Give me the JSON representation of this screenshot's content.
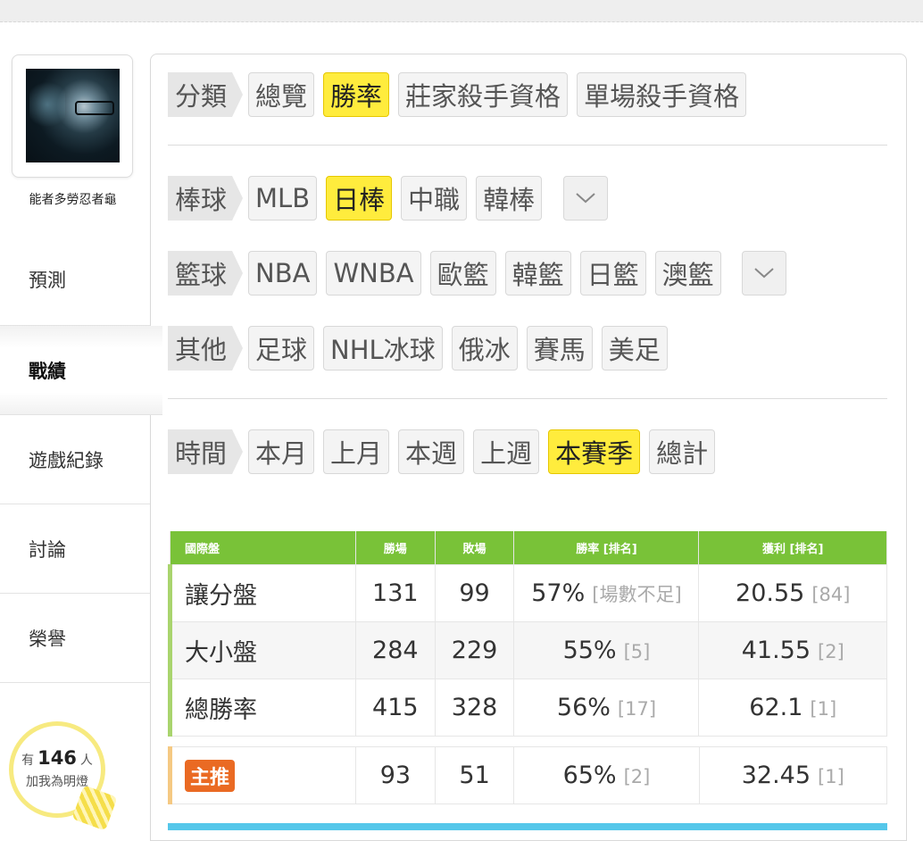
{
  "profile": {
    "username": "能者多勞忍者龜"
  },
  "nav": {
    "items": [
      {
        "label": "預測"
      },
      {
        "label": "戰績"
      },
      {
        "label": "遊戲紀錄"
      },
      {
        "label": "討論"
      },
      {
        "label": "榮譽"
      }
    ]
  },
  "fans": {
    "prefix": "有",
    "count": "146",
    "suffix": "人",
    "line2": "加我為明燈"
  },
  "filters": {
    "category": {
      "label": "分類",
      "options": [
        "總覽",
        "勝率",
        "莊家殺手資格",
        "單場殺手資格"
      ],
      "selected": "勝率"
    },
    "baseball": {
      "label": "棒球",
      "options": [
        "MLB",
        "日棒",
        "中職",
        "韓棒"
      ],
      "selected": "日棒"
    },
    "basketball": {
      "label": "籃球",
      "options": [
        "NBA",
        "WNBA",
        "歐籃",
        "韓籃",
        "日籃",
        "澳籃"
      ]
    },
    "other": {
      "label": "其他",
      "options": [
        "足球",
        "NHL冰球",
        "俄冰",
        "賽馬",
        "美足"
      ]
    },
    "time": {
      "label": "時間",
      "options": [
        "本月",
        "上月",
        "本週",
        "上週",
        "本賽季",
        "總計"
      ],
      "selected": "本賽季"
    }
  },
  "stats": {
    "headers": [
      "國際盤",
      "勝場",
      "敗場",
      "勝率 [排名]",
      "獲利 [排名]"
    ],
    "rows": [
      {
        "type": "讓分盤",
        "wins": "131",
        "losses": "99",
        "rate": "57%",
        "rate_rank": "[場數不足]",
        "profit": "20.55",
        "profit_rank": "[84]"
      },
      {
        "type": "大小盤",
        "wins": "284",
        "losses": "229",
        "rate": "55%",
        "rate_rank": "[5]",
        "profit": "41.55",
        "profit_rank": "[2]"
      },
      {
        "type": "總勝率",
        "wins": "415",
        "losses": "328",
        "rate": "56%",
        "rate_rank": "[17]",
        "profit": "62.1",
        "profit_rank": "[1]"
      }
    ],
    "main_pick": {
      "label": "主推",
      "wins": "93",
      "losses": "51",
      "rate": "65%",
      "rate_rank": "[2]",
      "profit": "32.45",
      "profit_rank": "[1]"
    }
  },
  "colors": {
    "selected_chip": "#ffec3d",
    "table_header": "#79c238",
    "main_pick_badge": "#ea6a23",
    "fan_ring": "#f7ea80"
  }
}
